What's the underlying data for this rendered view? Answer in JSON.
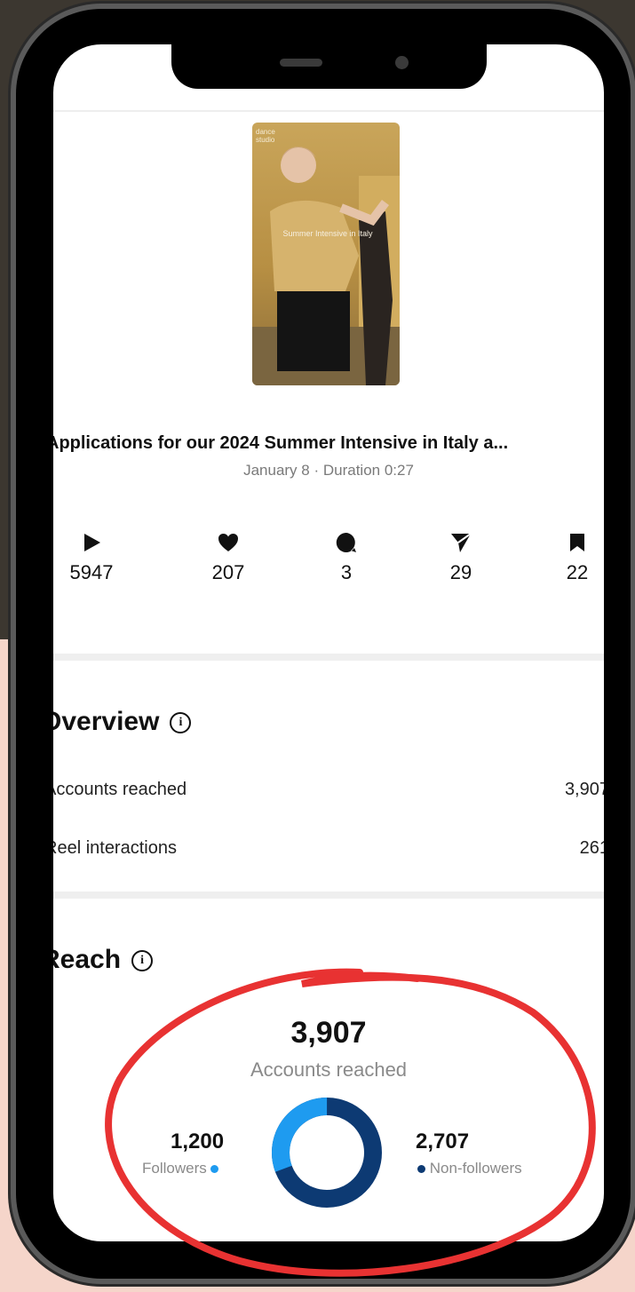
{
  "reel": {
    "thumbnail_tag": "dance\nstudio",
    "thumbnail_caption": "Summer Intensive in Italy",
    "title": "Applications for our 2024 Summer Intensive in Italy a...",
    "subtitle": "January 8 · Duration 0:27"
  },
  "stats": [
    {
      "icon": "play-icon",
      "value": "5947"
    },
    {
      "icon": "heart-icon",
      "value": "207"
    },
    {
      "icon": "comment-icon",
      "value": "3"
    },
    {
      "icon": "share-icon",
      "value": "29"
    },
    {
      "icon": "bookmark-icon",
      "value": "22"
    }
  ],
  "overview": {
    "title": "Overview",
    "rows": [
      {
        "label": "Accounts reached",
        "value": "3,907"
      },
      {
        "label": "Reel interactions",
        "value": "261"
      }
    ]
  },
  "reach": {
    "title": "Reach",
    "total": "3,907",
    "total_label": "Accounts reached",
    "followers_value": "1,200",
    "followers_label": "Followers",
    "nonfollowers_value": "2,707",
    "nonfollowers_label": "Non-followers",
    "followers_count": 1200,
    "nonfollowers_count": 2707,
    "colors": {
      "followers": "#1e9bf0",
      "nonfollowers": "#0d3a73"
    }
  },
  "annotation_color": "#e83232"
}
